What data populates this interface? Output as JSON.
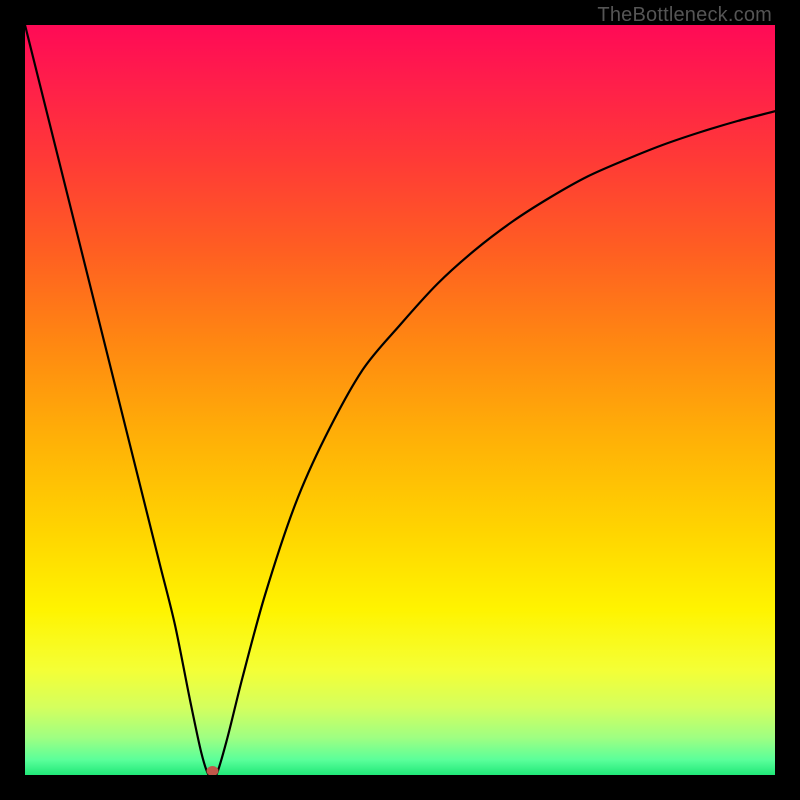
{
  "watermark": "TheBottleneck.com",
  "chart_data": {
    "type": "line",
    "title": "",
    "xlabel": "",
    "ylabel": "",
    "xlim": [
      0,
      100
    ],
    "ylim": [
      0,
      100
    ],
    "x": [
      0,
      2,
      4,
      6,
      8,
      10,
      12,
      14,
      16,
      18,
      20,
      22,
      23.5,
      24.5,
      25.5,
      27,
      29,
      32,
      36,
      40,
      45,
      50,
      55,
      60,
      65,
      70,
      75,
      80,
      85,
      90,
      95,
      100
    ],
    "values": [
      100,
      92,
      84,
      76,
      68,
      60,
      52,
      44,
      36,
      28,
      20,
      10,
      3,
      0,
      0,
      5,
      13,
      24,
      36,
      45,
      54,
      60,
      65.5,
      70,
      73.8,
      77,
      79.8,
      82,
      84,
      85.7,
      87.2,
      88.5
    ],
    "min_point": {
      "x": 25,
      "y": 0
    },
    "marker": {
      "x": 25,
      "y": 0,
      "color": "#c0574a"
    },
    "gradient_stops": [
      {
        "pos": 0.0,
        "color": "#ff0a56"
      },
      {
        "pos": 0.08,
        "color": "#ff1f4a"
      },
      {
        "pos": 0.18,
        "color": "#ff3a36"
      },
      {
        "pos": 0.3,
        "color": "#ff5e22"
      },
      {
        "pos": 0.42,
        "color": "#ff8612"
      },
      {
        "pos": 0.55,
        "color": "#ffb007"
      },
      {
        "pos": 0.68,
        "color": "#ffd600"
      },
      {
        "pos": 0.78,
        "color": "#fff400"
      },
      {
        "pos": 0.86,
        "color": "#f4ff36"
      },
      {
        "pos": 0.91,
        "color": "#d4ff5e"
      },
      {
        "pos": 0.95,
        "color": "#9fff82"
      },
      {
        "pos": 0.98,
        "color": "#5aff9a"
      },
      {
        "pos": 1.0,
        "color": "#20e878"
      }
    ]
  }
}
